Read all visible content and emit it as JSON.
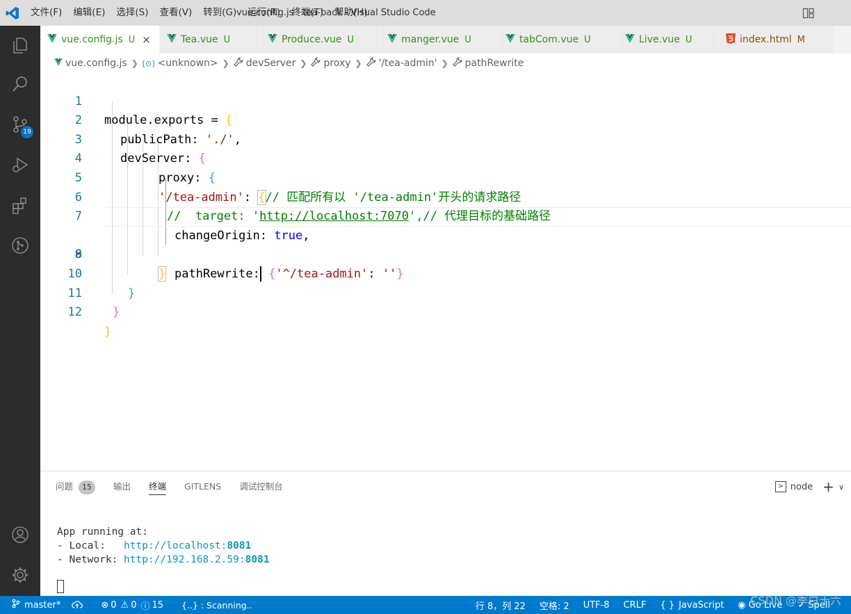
{
  "window": {
    "title": "vue.config.js - tea-back - Visual Studio Code",
    "menu": [
      "文件(F)",
      "编辑(E)",
      "选择(S)",
      "查看(V)",
      "转到(G)",
      "运行(R)",
      "终端(T)",
      "帮助(H)"
    ]
  },
  "activity_bar": {
    "items": [
      "explorer-icon",
      "search-icon",
      "source-control-icon",
      "run-debug-icon",
      "extensions-icon",
      "git-graph-icon"
    ],
    "source_control_badge": "19",
    "bottom": [
      "account-icon",
      "settings-gear-icon"
    ]
  },
  "tabs": [
    {
      "label": "vue.config.js",
      "status": "U",
      "close": "×",
      "icon": "vue-icon"
    },
    {
      "label": "Tea.vue",
      "status": "U",
      "icon": "vue-icon"
    },
    {
      "label": "Produce.vue",
      "status": "U",
      "icon": "vue-icon"
    },
    {
      "label": "manger.vue",
      "status": "U",
      "icon": "vue-icon"
    },
    {
      "label": "tabCom.vue",
      "status": "U",
      "icon": "vue-icon"
    },
    {
      "label": "Live.vue",
      "status": "U",
      "icon": "vue-icon"
    },
    {
      "label": "index.html",
      "status": "M",
      "icon": "html5-icon"
    }
  ],
  "breadcrumb": [
    "vue.config.js",
    "<unknown>",
    "devServer",
    "proxy",
    "'/tea-admin'",
    "pathRewrite"
  ],
  "editor": {
    "line_numbers": [
      "1",
      "2",
      "3",
      "4",
      "5",
      "6",
      "7",
      "8",
      "9",
      "10",
      "11",
      "12"
    ],
    "current_line": "8",
    "code": {
      "l1a": "module.exports = ",
      "l1b": "{",
      "l2a": "publicPath",
      "l2b": ": ",
      "l2c": "'./'",
      "l2d": ",",
      "l3a": "devServer",
      "l3b": ": ",
      "l3c": "{",
      "l4a": "proxy",
      "l4b": ": ",
      "l4c": "{",
      "l5a": "'/tea-admin'",
      "l5b": ": ",
      "l5c": "{",
      "l5d": "// 匹配所有以 '/tea-admin'开头的请求路径",
      "l6a": "//  target: '",
      "l6b": "http://localhost:7070",
      "l6c": "',// 代理目标的基础路径",
      "l7a": "changeOrigin",
      "l7b": ": ",
      "l7c": "true",
      "l7d": ",",
      "l8a": "pathRewrite",
      "l8b": ":",
      "l8c": " {",
      "l8d": "'^/tea-admin'",
      "l8e": ": ",
      "l8f": "''",
      "l8g": "}",
      "l9": "}",
      "l10": "}",
      "l11": "}",
      "l12": "}"
    }
  },
  "panel": {
    "tabs": [
      "问题",
      "输出",
      "终端",
      "GITLENS",
      "调试控制台"
    ],
    "problems_count": "15",
    "active_tab": "终端",
    "terminal_name": "node",
    "add_label": "+",
    "dropdown": "∨",
    "terminal": {
      "line1": "App running at:",
      "local_label": "- Local:   ",
      "local_url": "http://localhost:",
      "local_port": "8081",
      "network_label": "- Network: ",
      "network_url": "http://192.168.2.59:",
      "network_port": "8081"
    }
  },
  "statusbar": {
    "branch": "master*",
    "errors": "0",
    "warnings": "0",
    "info": "15",
    "scanning": "{..} : Scanning..",
    "position": "行 8，列 22",
    "spaces": "空格: 2",
    "encoding": "UTF-8",
    "eol": "CRLF",
    "language_braces": "{ }",
    "language": "JavaScript",
    "golive": "Go Live",
    "spell": "Spell"
  },
  "watermark": "CSDN @季白十六",
  "colors": {
    "statusbar": "#007acc",
    "activitybar": "#2c2c2c",
    "vue_green": "#3b8f1e",
    "keyword": "#0000ff",
    "string": "#a31515",
    "comment": "#008000"
  }
}
